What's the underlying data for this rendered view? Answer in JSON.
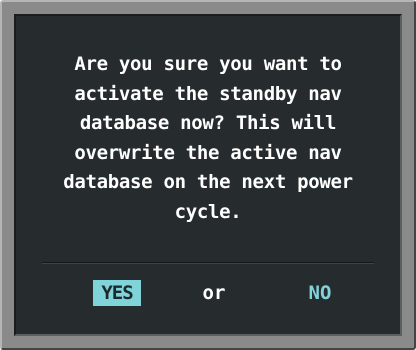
{
  "dialog": {
    "message_lines": [
      "Are you sure you want to",
      "activate the standby nav",
      "database now?  This will",
      "overwrite the active nav",
      "database on the next power",
      "cycle."
    ],
    "yes_label": "YES",
    "or_label": "or",
    "no_label": "NO",
    "selected_option": "YES"
  },
  "colors": {
    "screen_background": "#262b2d",
    "bezel": "#8a8a8a",
    "text": "#ffffff",
    "accent_cyan": "#7fd3d9"
  }
}
